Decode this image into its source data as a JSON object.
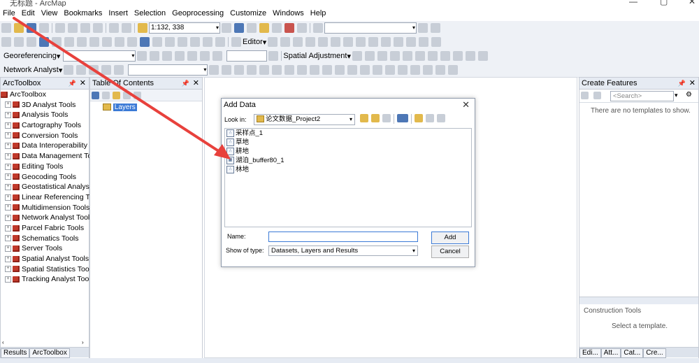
{
  "window": {
    "title": "无标题 - ArcMap"
  },
  "menu": [
    "File",
    "Edit",
    "View",
    "Bookmarks",
    "Insert",
    "Selection",
    "Geoprocessing",
    "Customize",
    "Windows",
    "Help"
  ],
  "toolbar1": {
    "scale": "1:132, 338"
  },
  "toolbar_labels": {
    "editor": "Editor",
    "georeferencing": "Georeferencing",
    "spatial_adjustment": "Spatial Adjustment",
    "network_analyst": "Network Analyst"
  },
  "arctoolbox": {
    "title": "ArcToolbox",
    "root": "ArcToolbox",
    "items": [
      "3D Analyst Tools",
      "Analysis Tools",
      "Cartography Tools",
      "Conversion Tools",
      "Data Interoperability T",
      "Data Management Too",
      "Editing Tools",
      "Geocoding Tools",
      "Geostatistical Analyst T",
      "Linear Referencing Too",
      "Multidimension Tools",
      "Network Analyst Tools",
      "Parcel Fabric Tools",
      "Schematics Tools",
      "Server Tools",
      "Spatial Analyst Tools",
      "Spatial Statistics Tools",
      "Tracking Analyst Tools"
    ],
    "tabs": [
      "Results",
      "ArcToolbox"
    ]
  },
  "toc": {
    "title": "Table Of Contents",
    "layers": "Layers"
  },
  "create_features": {
    "title": "Create Features",
    "search_placeholder": "<Search>",
    "empty_msg": "There are no templates to show.",
    "construction_tools": "Construction Tools",
    "select_template": "Select a template.",
    "tabs": [
      "Edi...",
      "Att...",
      "Cat...",
      "Cre..."
    ]
  },
  "dialog": {
    "title": "Add Data",
    "look_in_label": "Look in:",
    "look_in_value": "论文数据_Project2",
    "files": [
      "采样点_1",
      "草地",
      "耕地",
      "湖泊_buffer80_1",
      "林地"
    ],
    "name_label": "Name:",
    "name_value": "",
    "show_type_label": "Show of type:",
    "show_type_value": "Datasets, Layers and Results",
    "add_label": "Add",
    "cancel_label": "Cancel"
  },
  "colors": {
    "arrow": "#e8413c",
    "accent": "#3b7ad6",
    "toolbox_red": "#c0392b"
  }
}
